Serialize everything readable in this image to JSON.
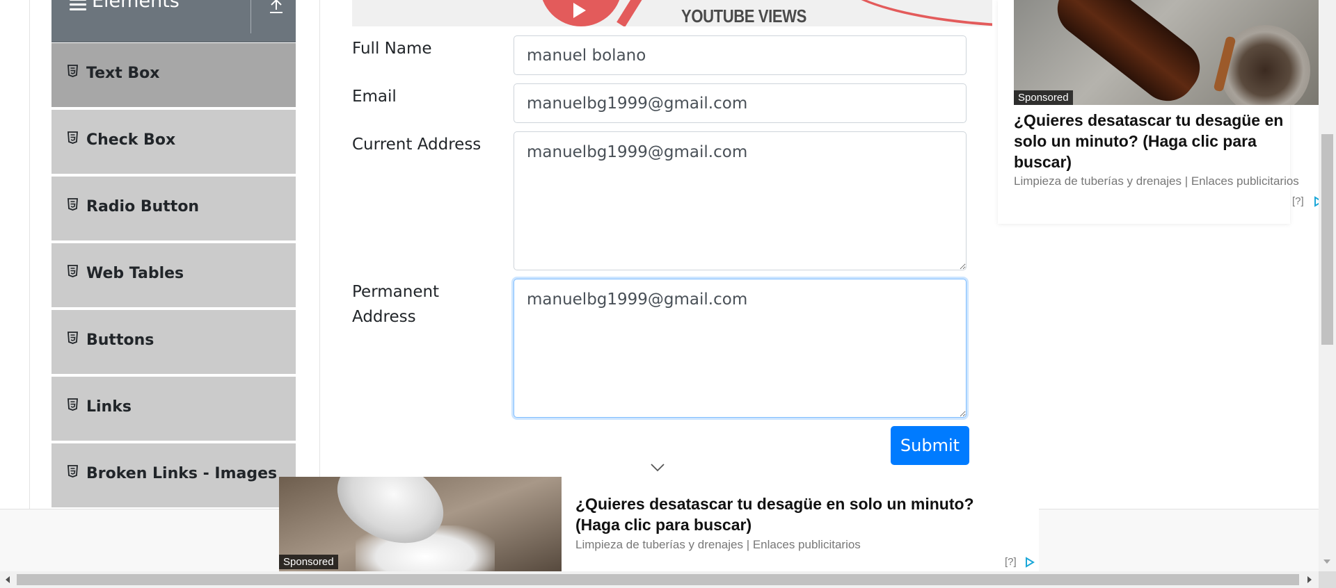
{
  "sidebar": {
    "group_title": "Elements",
    "items": [
      {
        "label": "Text Box",
        "active": true
      },
      {
        "label": "Check Box",
        "active": false
      },
      {
        "label": "Radio Button",
        "active": false
      },
      {
        "label": "Web Tables",
        "active": false
      },
      {
        "label": "Buttons",
        "active": false
      },
      {
        "label": "Links",
        "active": false
      },
      {
        "label": "Broken Links - Images",
        "active": false
      }
    ]
  },
  "banner": {
    "text": "YOUTUBE VIEWS"
  },
  "form": {
    "full_name_label": "Full Name",
    "full_name_value": "manuel bolano",
    "email_label": "Email",
    "email_value": "manuelbg1999@gmail.com",
    "current_address_label": "Current Address",
    "current_address_value": "manuelbg1999@gmail.com",
    "permanent_address_label": "Permanent Address",
    "permanent_address_value": "manuelbg1999@gmail.com",
    "submit_label": "Submit"
  },
  "ad_right": {
    "sponsored": "Sponsored",
    "title": "¿Quieres desatascar tu desagüe en solo un minuto? (Haga clic para buscar)",
    "source": "Limpieza de tuberías y drenajes | Enlaces publicitarios",
    "help": "[?]"
  },
  "ad_bottom": {
    "sponsored": "Sponsored",
    "title": "¿Quieres desatascar tu desagüe en solo un minuto? (Haga clic para buscar)",
    "source": "Limpieza de tuberías y drenajes | Enlaces publicitarios",
    "help": "[?]"
  },
  "colors": {
    "primary": "#007bff",
    "sidebar_header": "#6c757d",
    "menu_item": "#cbcbcb",
    "menu_item_active": "#a7a7a7"
  },
  "icons": {
    "menu": "hamburger-icon",
    "collapse": "collapse-up-icon",
    "item": "html5-icon",
    "chevron": "chevron-down-icon",
    "adchoices": "adchoices-icon"
  }
}
